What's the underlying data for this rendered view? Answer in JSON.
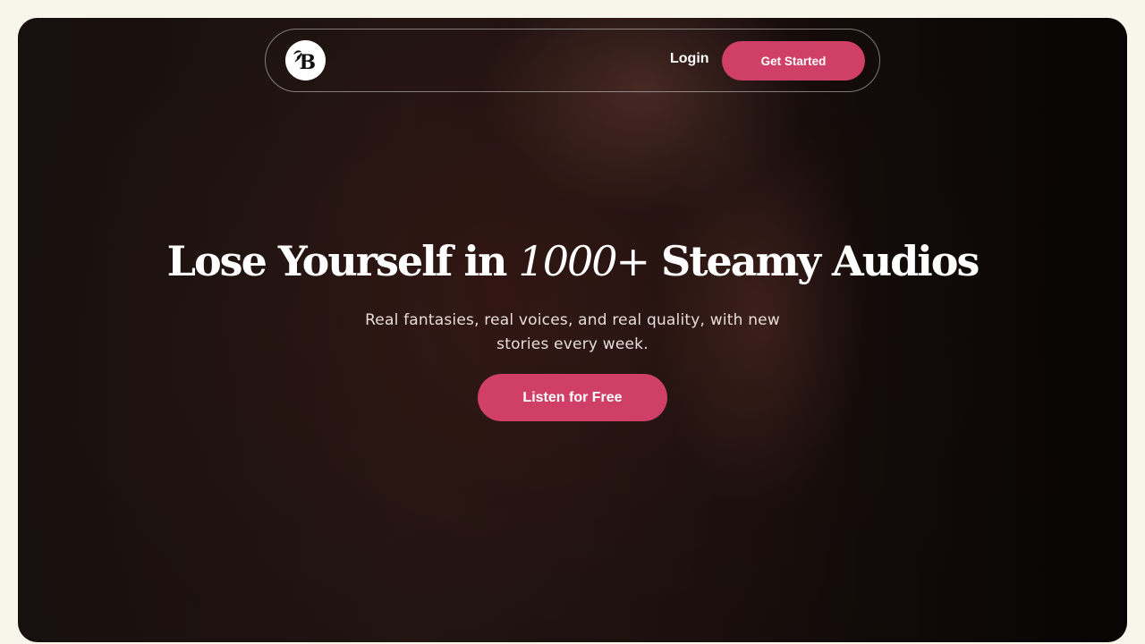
{
  "nav": {
    "logo_letter": "B",
    "login_label": "Login",
    "get_started_label": "Get Started"
  },
  "hero": {
    "headline_before": "Lose Yourself in ",
    "headline_emphasis": "1000+",
    "headline_after": " Steamy Audios",
    "subtext": "Real fantasies, real voices, and real quality, with new stories every week.",
    "cta_label": "Listen for Free"
  },
  "colors": {
    "accent": "#cf3f66",
    "page_background": "#f8f6ea",
    "hero_background": "#1f1512"
  },
  "icons": {
    "logo": "leaf-b-logo-icon"
  }
}
